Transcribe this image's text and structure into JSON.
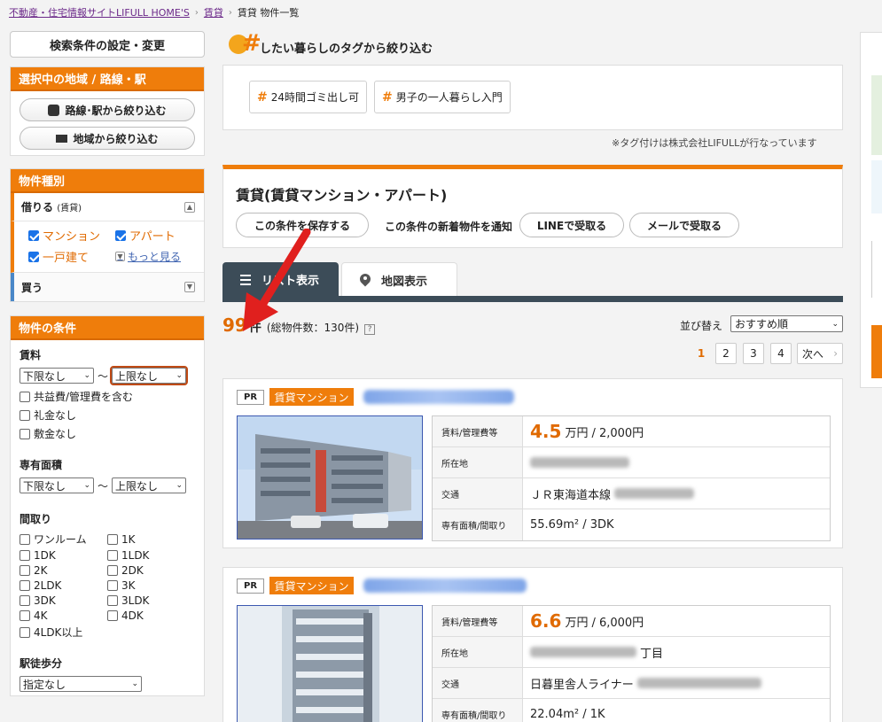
{
  "breadcrumb": {
    "site": "不動産・住宅情報サイトLIFULL HOME'S",
    "rent": "賃貸",
    "current": "賃貸 物件一覧"
  },
  "sidebar": {
    "search_settings_label": "検索条件の設定・変更",
    "area_panel": {
      "title": "選択中の地域 / 路線・駅",
      "route_button": "路線･駅から絞り込む",
      "area_button": "地域から絞り込む"
    },
    "kind_panel": {
      "title": "物件種別",
      "rent_label": "借りる",
      "rent_sub": "(賃貸)",
      "options": [
        {
          "label": "マンション",
          "checked": true
        },
        {
          "label": "アパート",
          "checked": true
        },
        {
          "label": "一戸建て",
          "checked": true
        }
      ],
      "more_label": "もっと見る",
      "buy_label": "買う"
    },
    "conditions_panel": {
      "title": "物件の条件",
      "rent_label": "賃料",
      "rent_min": "下限なし",
      "rent_max": "上限なし",
      "range_sep": "～",
      "rent_checks": [
        "共益費/管理費を含む",
        "礼金なし",
        "敷金なし"
      ],
      "area_label": "専有面積",
      "area_min": "下限なし",
      "area_max": "上限なし",
      "layout_label": "間取り",
      "layouts": [
        "ワンルーム",
        "1K",
        "1DK",
        "1LDK",
        "2K",
        "2DK",
        "2LDK",
        "3K",
        "3DK",
        "3LDK",
        "4K",
        "4DK",
        "4LDK以上"
      ],
      "walk_label": "駅徒歩分",
      "walk_value": "指定なし"
    }
  },
  "tags": {
    "heading": "したい暮らしのタグから絞り込む",
    "items": [
      "24時間ゴミ出し可",
      "男子の一人暮らし入門"
    ],
    "note": "※タグ付けは株式会社LIFULLが行なっています"
  },
  "condition_card": {
    "title": "賃貸(賃貸マンション・アパート)",
    "save_button": "この条件を保存する",
    "notify_label": "この条件の新着物件を通知",
    "line_button": "LINEで受取る",
    "mail_button": "メールで受取る"
  },
  "tabs": {
    "list_label": "リスト表示",
    "map_label": "地図表示"
  },
  "results": {
    "count": "99",
    "count_unit": "件",
    "total": "(総物件数：130件)",
    "help": "?"
  },
  "sort": {
    "label": "並び替え",
    "value": "おすすめ順"
  },
  "pager": {
    "current": "1",
    "pages": [
      "2",
      "3",
      "4"
    ],
    "next": "次へ"
  },
  "listings": [
    {
      "pr": "PR",
      "type": "賃貸マンション",
      "rent_key": "賃料/管理費等",
      "rent_value": "4.5",
      "rent_unit": "万円",
      "rent_fee": "/ 2,000円",
      "address_key": "所在地",
      "access_key": "交通",
      "access_value": "ＪＲ東海道本線",
      "area_key": "専有面積/間取り",
      "area_value": "55.69m² / 3DK"
    },
    {
      "pr": "PR",
      "type": "賃貸マンション",
      "rent_key": "賃料/管理費等",
      "rent_value": "6.6",
      "rent_unit": "万円",
      "rent_fee": "/ 6,000円",
      "address_key": "所在地",
      "address_value": "丁目",
      "access_key": "交通",
      "access_value": "日暮里舎人ライナー",
      "area_key": "専有面積/間取り",
      "area_value": "22.04m² / 1K"
    }
  ],
  "colors": {
    "accent_orange": "#ef7d0b",
    "tab_dark": "#3c4c58",
    "price_orange": "#e06a00",
    "annotation_red": "#e0201e"
  }
}
